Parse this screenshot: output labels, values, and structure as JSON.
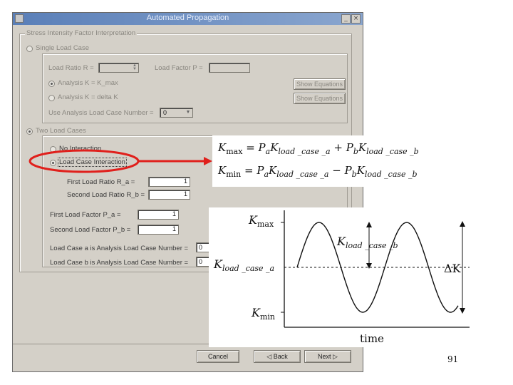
{
  "window": {
    "title": "Automated Propagation",
    "group_title": "Stress Intensity Factor Interpretation",
    "single_load_case": {
      "label": "Single Load Case",
      "load_ratio_label": "Load Ratio R =",
      "load_factor_label": "Load Factor P =",
      "analysis_kmax_label": "Analysis K = K_max",
      "analysis_delta_label": "Analysis K = delta K",
      "show_equations_1": "Show Equations",
      "show_equations_2": "Show Equations",
      "use_lc_label": "Use Analysis Load Case Number =",
      "use_lc_value": "0"
    },
    "two_load_cases": {
      "label": "Two Load Cases",
      "no_interaction": "No Interaction",
      "load_case_interaction": "Load Case Interaction",
      "first_load_ratio_label": "First Load Ratio R_a =",
      "first_load_ratio_value": "1",
      "second_load_ratio_label": "Second Load Ratio R_b =",
      "second_load_ratio_value": "1",
      "first_load_factor_label": "First Load Factor P_a =",
      "first_load_factor_value": "1",
      "second_load_factor_label": "Second Load Factor P_b =",
      "second_load_factor_value": "1",
      "lc_a_label": "Load Case a is Analysis Load Case Number =",
      "lc_a_value": "0",
      "lc_b_label": "Load Case b is Analysis Load Case Number =",
      "lc_b_value": "0"
    },
    "buttons": {
      "cancel": "Cancel",
      "back": "◁ Back",
      "next": "Next ▷"
    }
  },
  "highlight_color": "#e0201c",
  "equations": {
    "kmax": {
      "lhs": "K",
      "lhs_sub": "max",
      "t1": "P",
      "t1_sub": "a",
      "t1k": "K",
      "t1k_sub": "load _case _a",
      "op": "+",
      "t2": "P",
      "t2_sub": "b",
      "t2k": "K",
      "t2k_sub": "load _case _b"
    },
    "kmin": {
      "lhs": "K",
      "lhs_sub": "min",
      "t1": "P",
      "t1_sub": "a",
      "t1k": "K",
      "t1k_sub": "load _case _a",
      "op": "−",
      "t2": "P",
      "t2_sub": "b",
      "t2k": "K",
      "t2k_sub": "load _case _b"
    }
  },
  "plot": {
    "kmax_label": "K",
    "kmax_sub": "max",
    "kmin_label": "K",
    "kmin_sub": "min",
    "kcase_a": "K",
    "kcase_a_sub": "load _case _a",
    "kcase_b": "K",
    "kcase_b_sub": "load _case _b",
    "delta_k": "ΔK",
    "time_label": "time"
  },
  "page_number": "91"
}
